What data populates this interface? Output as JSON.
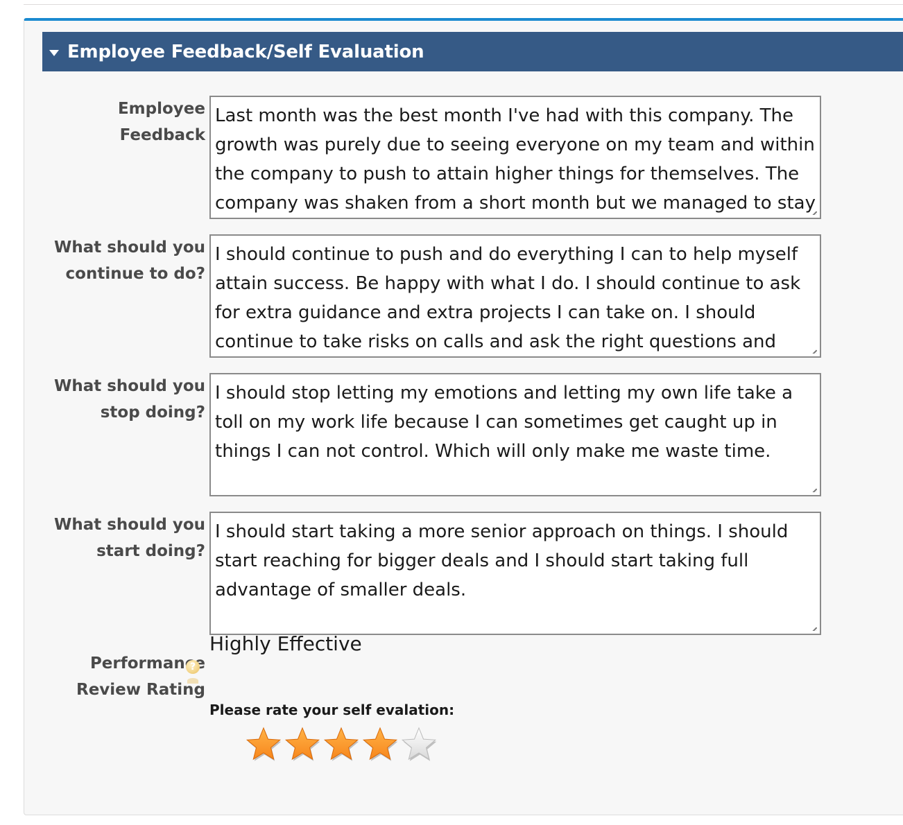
{
  "section": {
    "title": "Employee Feedback/Self Evaluation"
  },
  "fields": [
    {
      "label": "Employee Feedback",
      "value": "Last month was the best month I've had with this company. The growth was purely due to seeing everyone on my team and within the company to push to attain higher things for themselves.  The company was shaken from a short month but we managed to stay"
    },
    {
      "label": "What should you continue to do?",
      "value": "I should continue to push and do everything I can to help myself attain success. Be happy with what I do. I should continue to ask for extra guidance and extra projects I can take on. I should continue to take risks on calls and ask the right questions and"
    },
    {
      "label": "What should you stop doing?",
      "value": "I should stop letting my emotions and letting my own life take a toll on my work life because I can sometimes get caught up in things I can not control. Which will only make me waste time."
    },
    {
      "label": "What should you start doing?",
      "value": "I should start taking a more senior approach on things. I should start reaching for bigger deals and I should start taking full advantage of smaller deals."
    }
  ],
  "performance": {
    "label": "Performance Review Rating",
    "value": "Highly Effective"
  },
  "self_rating": {
    "label": "Please rate your self evalation:",
    "rating": 4,
    "max": 5,
    "filled_color": "#f7861c",
    "empty_color": "#d9d9d9"
  },
  "colors": {
    "header_bg": "#365a86",
    "accent_top": "#1b8ad0"
  }
}
